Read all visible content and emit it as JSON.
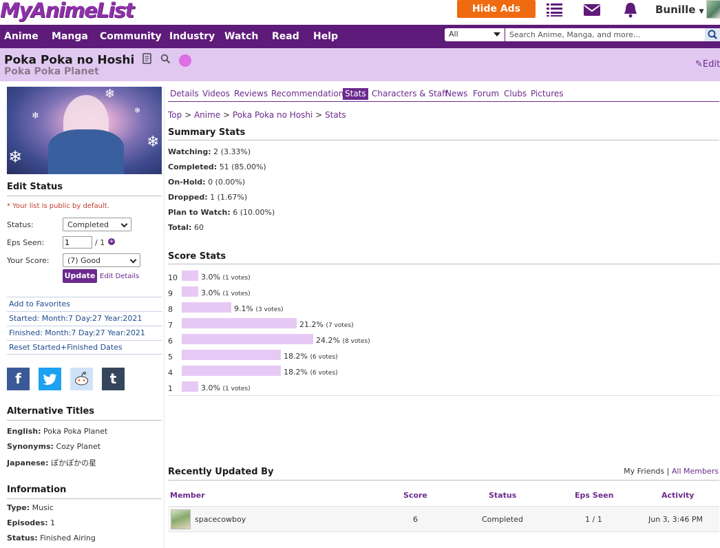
{
  "header": {
    "logo": "MyAnimeList",
    "hide_ads": "Hide Ads",
    "username": "Bunille"
  },
  "nav": {
    "items": [
      "Anime",
      "Manga",
      "Community",
      "Industry",
      "Watch",
      "Read",
      "Help"
    ],
    "search_category": "All",
    "search_placeholder": "Search Anime, Manga, and more..."
  },
  "title": {
    "main": "Poka Poka no Hoshi",
    "alt": "Poka Poka Planet",
    "edit": "Edit"
  },
  "left": {
    "edit_status_heading": "Edit Status",
    "public_note": "* Your list is public by default.",
    "status_label": "Status:",
    "status_value": "Completed",
    "eps_label": "Eps Seen:",
    "eps_value": "1",
    "eps_total": "/ 1",
    "score_label": "Your Score:",
    "score_value": "(7) Good",
    "update_button": "Update",
    "edit_details": "Edit Details",
    "links": [
      "Add to Favorites",
      "Started: Month:7 Day:27 Year:2021",
      "Finished: Month:7 Day:27 Year:2021",
      "Reset Started+Finished Dates"
    ],
    "alt_titles_heading": "Alternative Titles",
    "alt_titles": [
      {
        "key": "English:",
        "value": "Poka Poka Planet"
      },
      {
        "key": "Synonyms:",
        "value": "Cozy Planet"
      },
      {
        "key": "Japanese:",
        "value": "ぽかぽかの星"
      }
    ],
    "info_heading": "Information",
    "info": [
      {
        "key": "Type:",
        "value": "Music"
      },
      {
        "key": "Episodes:",
        "value": "1"
      },
      {
        "key": "Status:",
        "value": "Finished Airing"
      }
    ]
  },
  "tabs": [
    "Details",
    "Videos",
    "Reviews",
    "Recommendations",
    "Stats",
    "Characters & Staff",
    "News",
    "Forum",
    "Clubs",
    "Pictures"
  ],
  "active_tab": "Stats",
  "breadcrumb": [
    "Top",
    "Anime",
    "Poka Poka no Hoshi",
    "Stats"
  ],
  "summary": {
    "heading": "Summary Stats",
    "lines": [
      {
        "key": "Watching:",
        "value": "2 (3.33%)"
      },
      {
        "key": "Completed:",
        "value": "51 (85.00%)"
      },
      {
        "key": "On-Hold:",
        "value": "0 (0.00%)"
      },
      {
        "key": "Dropped:",
        "value": "1 (1.67%)"
      },
      {
        "key": "Plan to Watch:",
        "value": "6 (10.00%)"
      },
      {
        "key": "Total:",
        "value": "60"
      }
    ]
  },
  "score_stats": {
    "heading": "Score Stats",
    "rows": [
      {
        "score": "10",
        "pct": 3.0,
        "pct_label": "3.0%",
        "votes": "(1 votes)"
      },
      {
        "score": "9",
        "pct": 3.0,
        "pct_label": "3.0%",
        "votes": "(1 votes)"
      },
      {
        "score": "8",
        "pct": 9.1,
        "pct_label": "9.1%",
        "votes": "(3 votes)"
      },
      {
        "score": "7",
        "pct": 21.2,
        "pct_label": "21.2%",
        "votes": "(7 votes)"
      },
      {
        "score": "6",
        "pct": 24.2,
        "pct_label": "24.2%",
        "votes": "(8 votes)"
      },
      {
        "score": "5",
        "pct": 18.2,
        "pct_label": "18.2%",
        "votes": "(6 votes)"
      },
      {
        "score": "4",
        "pct": 18.2,
        "pct_label": "18.2%",
        "votes": "(6 votes)"
      },
      {
        "score": "1",
        "pct": 3.0,
        "pct_label": "3.0%",
        "votes": "(1 votes)"
      }
    ]
  },
  "recent": {
    "heading": "Recently Updated By",
    "filter_friends": "My Friends",
    "filter_sep": "|",
    "filter_all": "All Members",
    "columns": [
      "Member",
      "Score",
      "Status",
      "Eps Seen",
      "Activity"
    ],
    "rows": [
      {
        "member": "spacecowboy",
        "score": "6",
        "status": "Completed",
        "eps": "1 / 1",
        "activity": "Jun 3, 3:46 PM"
      }
    ]
  },
  "colors": {
    "brand": "#5e1b79",
    "accent": "#ef6a10",
    "title_bar": "#e1c8f0",
    "score_bar": "#e6c9f4"
  }
}
